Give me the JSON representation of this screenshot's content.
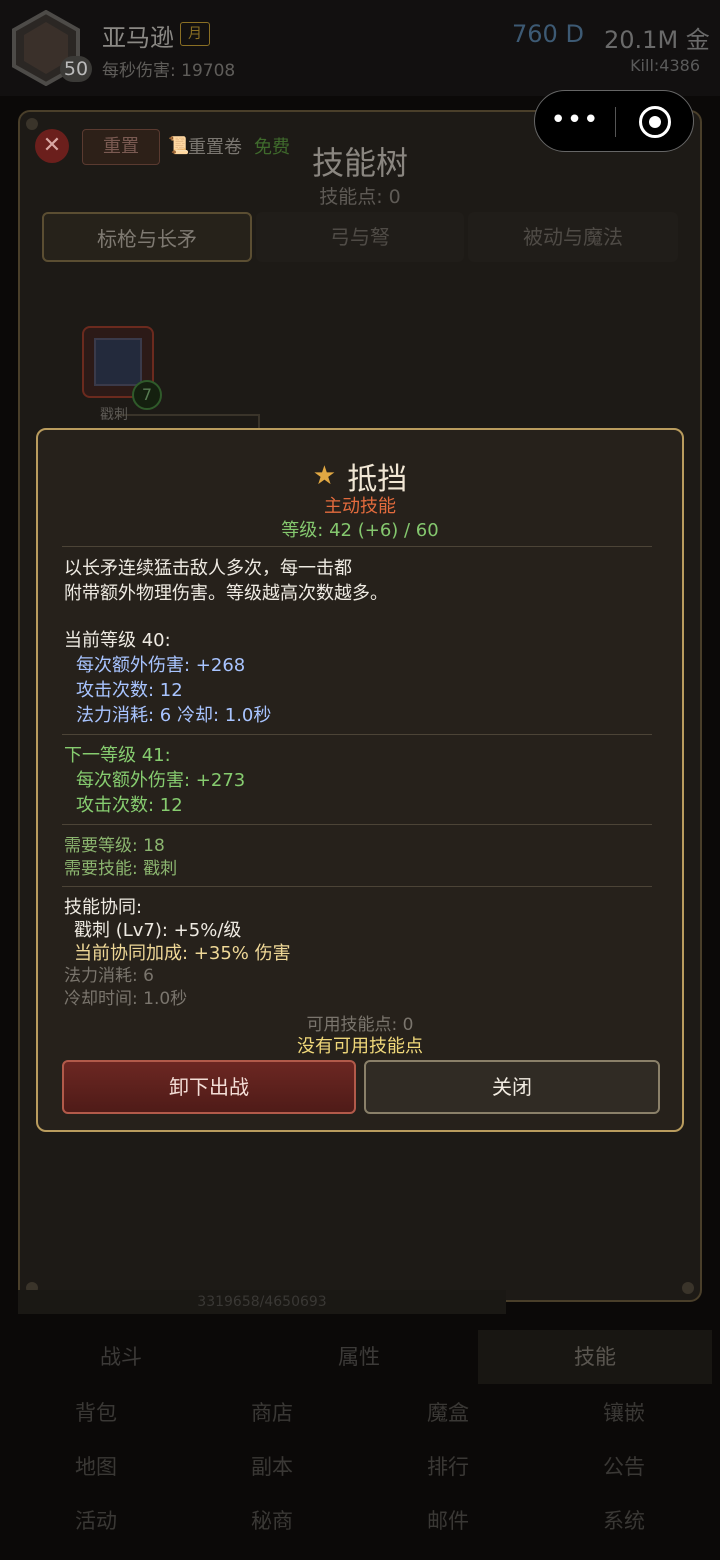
{
  "player": {
    "name": "亚马逊",
    "tag": "月",
    "level": "50",
    "dps": "每秒伤害: 19708",
    "diamonds": "760 D",
    "gold": "20.1M 金",
    "kills": "Kill:4386"
  },
  "capsule": {
    "more_icon": "more-dots-icon",
    "close_icon": "target-icon",
    "more_glyph": "•••"
  },
  "skill_tree": {
    "close_glyph": "✕",
    "reset_label": "重置",
    "scroll_icon": "📜",
    "scroll_label": "重置卷",
    "free_label": "免费",
    "title": "技能树",
    "points": "技能点: 0",
    "tabs": [
      "标枪与长矛",
      "弓与弩",
      "被动与魔法"
    ],
    "node": {
      "name": "戳刺",
      "level": "7"
    },
    "bottom_text": "3319658/4650693"
  },
  "nav": {
    "main": [
      "战斗",
      "属性",
      "技能"
    ],
    "grid": [
      "背包",
      "商店",
      "魔盒",
      "镶嵌",
      "地图",
      "副本",
      "排行",
      "公告",
      "活动",
      "秘商",
      "邮件",
      "系统"
    ]
  },
  "tooltip": {
    "icon": "shield-icon",
    "icon_glyph": "★",
    "title": "抵挡",
    "type": "主动技能",
    "level": "等级: 42 (+6) / 60",
    "desc_line1": "以长矛连续猛击敌人多次，每一击都",
    "desc_line2": "附带额外物理伤害。等级越高次数越多。",
    "current_header": "当前等级 40:",
    "current_dmg": "每次额外伤害: +268",
    "current_hits": "攻击次数: 12",
    "current_cost": "法力消耗: 6  冷却: 1.0秒",
    "next_header": "下一等级 41:",
    "next_dmg": "每次额外伤害: +273",
    "next_hits": "攻击次数: 12",
    "req_level": "需要等级: 18",
    "req_skill": "需要技能: 戳刺",
    "synergy_header": "技能协同:",
    "synergy_item": "戳刺 (Lv7): +5%/级",
    "synergy_bonus": "当前协同加成: +35% 伤害",
    "mana_cost": "法力消耗: 6",
    "cooldown": "冷却时间: 1.0秒",
    "available_points": "可用技能点: 0",
    "no_points": "没有可用技能点",
    "unequip_label": "卸下出战",
    "close_label": "关闭"
  }
}
